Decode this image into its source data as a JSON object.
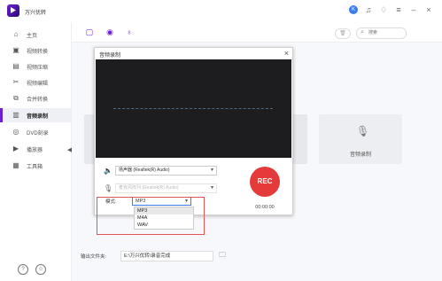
{
  "app": {
    "title": "万兴优转"
  },
  "titlebar": {
    "avatar_label": "K",
    "icons": [
      "avatar-icon",
      "headset-icon",
      "gift-icon",
      "menu-icon",
      "minimize-icon",
      "close-icon"
    ]
  },
  "sidebar": {
    "items": [
      {
        "label": "主页",
        "icon": "home-icon"
      },
      {
        "label": "视频转换",
        "icon": "convert-icon"
      },
      {
        "label": "视频压缩",
        "icon": "compress-icon"
      },
      {
        "label": "视频编辑",
        "icon": "edit-icon"
      },
      {
        "label": "合并转换",
        "icon": "merge-icon"
      },
      {
        "label": "音频录制",
        "icon": "audio-record-icon",
        "active": true
      },
      {
        "label": "DVD刻录",
        "icon": "dvd-icon"
      },
      {
        "label": "播放器",
        "icon": "player-icon"
      },
      {
        "label": "工具箱",
        "icon": "toolbox-icon"
      }
    ]
  },
  "toolbar": {
    "search_placeholder": "搜索"
  },
  "audio_card": {
    "label": "音频录制"
  },
  "output": {
    "label": "输出文件夹:",
    "path": "E:\\万兴优转\\录音完成"
  },
  "dialog": {
    "title": "音频录制",
    "speaker_device": "扬声器 (Realtek(R) Audio)",
    "mic_device": "麦克风阵列 (Realtek(R) Audio)",
    "rec_label": "REC",
    "timer": "00:00:00",
    "mode_label": "模式:",
    "mode_selected": "MP3",
    "mode_options": [
      "MP3",
      "M4A",
      "WAV"
    ]
  },
  "colors": {
    "accent": "#6a1fd6",
    "rec": "#e53a3a",
    "highlight_box": "#e05555"
  }
}
